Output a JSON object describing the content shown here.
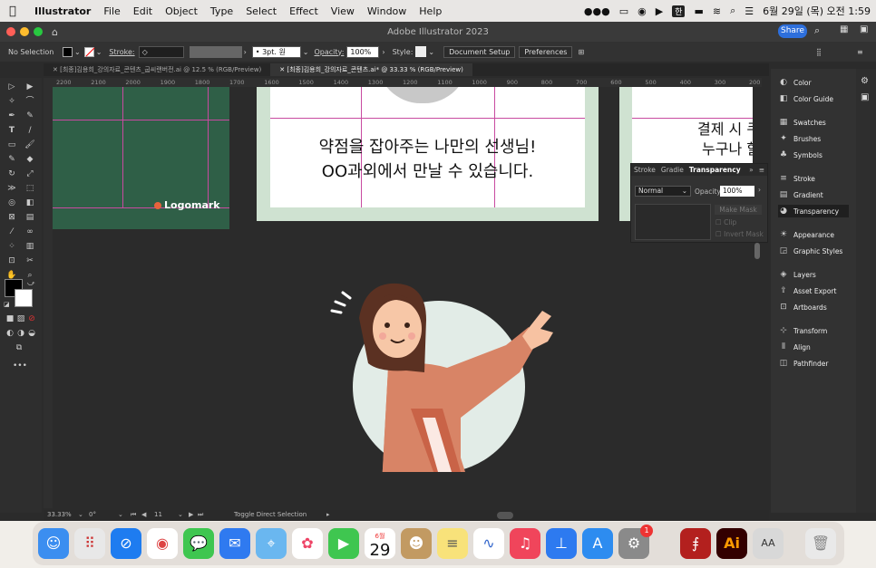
{
  "menubar": {
    "app": "Illustrator",
    "items": [
      "File",
      "Edit",
      "Object",
      "Type",
      "Select",
      "Effect",
      "View",
      "Window",
      "Help"
    ],
    "input_method": "한",
    "datetime": "6월 29일 (목) 오전 1:59"
  },
  "window": {
    "title": "Adobe Illustrator 2023",
    "share": "Share"
  },
  "control": {
    "selection": "No Selection",
    "stroke_label": "Stroke:",
    "brush": "3pt. 원",
    "opacity_label": "Opacity:",
    "opacity": "100%",
    "style_label": "Style:",
    "doc_setup": "Document Setup",
    "preferences": "Preferences"
  },
  "tabs": [
    {
      "label": "[최종]김용희_강의자료_콘텐츠_굽씨랜버전.ai @ 12.5 % (RGB/Preview)"
    },
    {
      "label": "[최종]김용희_강의자료_콘텐츠.ai* @ 33.33 % (RGB/Preview)"
    }
  ],
  "ruler_labels": [
    "2200",
    "2100",
    "2000",
    "1900",
    "1800",
    "1700",
    "1600",
    "1500",
    "1400",
    "1300",
    "1200",
    "1100",
    "1000",
    "900",
    "800",
    "700",
    "600",
    "500",
    "400",
    "300",
    "200"
  ],
  "artboards": {
    "logomark": "Logomark",
    "main_line1": "약점을 잡아주는 나만의 선생님!",
    "main_line2": "OO과외에서 만날 수 있습니다.",
    "right_line1": "결제 시 쿠",
    "right_line2": "누구나 할"
  },
  "transparency_panel": {
    "tabs": [
      "Stroke",
      "Gradie",
      "Transparency"
    ],
    "blend_mode": "Normal",
    "opacity_label": "Opacity:",
    "opacity": "100%",
    "make_mask": "Make Mask",
    "clip": "Clip",
    "invert_mask": "Invert Mask"
  },
  "right_panel": {
    "items": [
      {
        "label": "Color",
        "icon": "color-icon"
      },
      {
        "label": "Color Guide",
        "icon": "color-guide-icon"
      },
      {
        "label": "Swatches",
        "icon": "swatches-icon"
      },
      {
        "label": "Brushes",
        "icon": "brushes-icon"
      },
      {
        "label": "Symbols",
        "icon": "symbols-icon"
      },
      {
        "label": "Stroke",
        "icon": "stroke-icon"
      },
      {
        "label": "Gradient",
        "icon": "gradient-icon"
      },
      {
        "label": "Transparency",
        "icon": "transparency-icon"
      },
      {
        "label": "Appearance",
        "icon": "appearance-icon"
      },
      {
        "label": "Graphic Styles",
        "icon": "graphic-styles-icon"
      },
      {
        "label": "Layers",
        "icon": "layers-icon"
      },
      {
        "label": "Asset Export",
        "icon": "asset-export-icon"
      },
      {
        "label": "Artboards",
        "icon": "artboards-icon"
      },
      {
        "label": "Transform",
        "icon": "transform-icon"
      },
      {
        "label": "Align",
        "icon": "align-icon"
      },
      {
        "label": "Pathfinder",
        "icon": "pathfinder-icon"
      }
    ]
  },
  "status": {
    "zoom": "33.33%",
    "rotation": "0°",
    "artboard": "11",
    "tool": "Toggle Direct Selection"
  },
  "dock": {
    "calendar_month": "6월",
    "calendar_day": "29",
    "badge": "1",
    "ai_label": "Ai",
    "font_label": "AA"
  },
  "colors": {
    "accent": "#2d6fdc",
    "artboard_green": "#2f5f47",
    "logo_dot": "#e7623c",
    "guide": "#c84aa0",
    "frame_green": "#cfe2d1"
  }
}
